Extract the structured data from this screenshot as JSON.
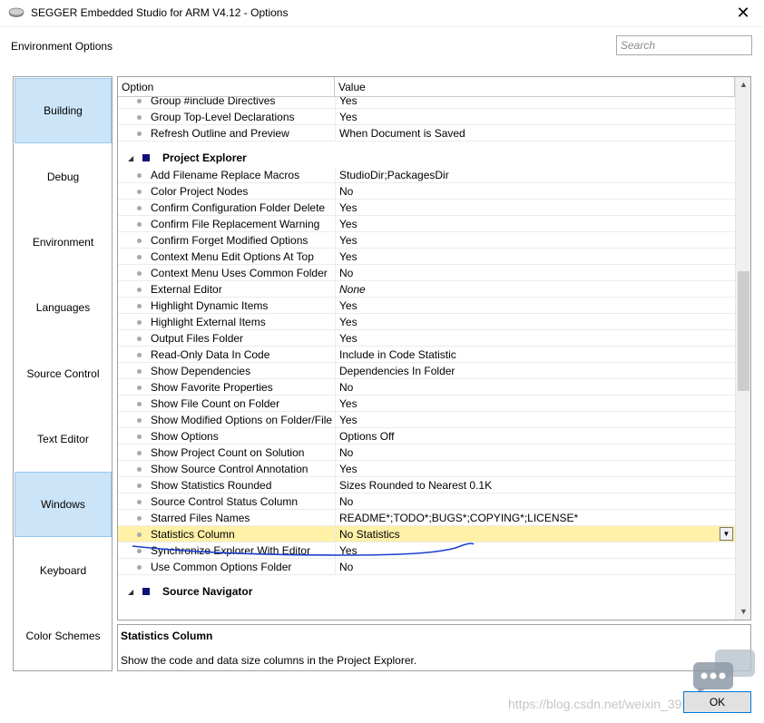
{
  "window": {
    "title": "SEGGER Embedded Studio for ARM V4.12 - Options",
    "close_glyph": "✕"
  },
  "header": {
    "title": "Environment Options",
    "search_placeholder": "Search"
  },
  "sidebar": {
    "items": [
      {
        "label": "Building"
      },
      {
        "label": "Debug"
      },
      {
        "label": "Environment"
      },
      {
        "label": "Languages"
      },
      {
        "label": "Source Control"
      },
      {
        "label": "Text Editor"
      },
      {
        "label": "Windows"
      },
      {
        "label": "Keyboard"
      },
      {
        "label": "Color Schemes"
      }
    ]
  },
  "grid": {
    "columns": [
      "Option",
      "Value"
    ],
    "top_rows": [
      {
        "name": "Group #include Directives",
        "value": "Yes"
      },
      {
        "name": "Group Top-Level Declarations",
        "value": "Yes"
      },
      {
        "name": "Refresh Outline and Preview",
        "value": "When Document is Saved"
      }
    ],
    "group1": "Project Explorer",
    "rows": [
      {
        "name": "Add Filename Replace Macros",
        "value": "StudioDir;PackagesDir"
      },
      {
        "name": "Color Project Nodes",
        "value": "No"
      },
      {
        "name": "Confirm Configuration Folder Delete",
        "value": "Yes"
      },
      {
        "name": "Confirm File Replacement Warning",
        "value": "Yes"
      },
      {
        "name": "Confirm Forget Modified Options",
        "value": "Yes"
      },
      {
        "name": "Context Menu Edit Options At Top",
        "value": "Yes"
      },
      {
        "name": "Context Menu Uses Common Folder",
        "value": "No"
      },
      {
        "name": "External Editor",
        "value": "None"
      },
      {
        "name": "Highlight Dynamic Items",
        "value": "Yes"
      },
      {
        "name": "Highlight External Items",
        "value": "Yes"
      },
      {
        "name": "Output Files Folder",
        "value": "Yes"
      },
      {
        "name": "Read-Only Data In Code",
        "value": "Include in Code Statistic"
      },
      {
        "name": "Show Dependencies",
        "value": "Dependencies In Folder"
      },
      {
        "name": "Show Favorite Properties",
        "value": "No"
      },
      {
        "name": "Show File Count on Folder",
        "value": "Yes"
      },
      {
        "name": "Show Modified Options on Folder/File",
        "value": "Yes"
      },
      {
        "name": "Show Options",
        "value": "Options Off"
      },
      {
        "name": "Show Project Count on Solution",
        "value": "No"
      },
      {
        "name": "Show Source Control Annotation",
        "value": "Yes"
      },
      {
        "name": "Show Statistics Rounded",
        "value": "Sizes Rounded to Nearest 0.1K"
      },
      {
        "name": "Source Control Status Column",
        "value": "No"
      },
      {
        "name": "Starred Files Names",
        "value": "README*;TODO*;BUGS*;COPYING*;LICENSE*"
      },
      {
        "name": "Statistics Column",
        "value": "No Statistics"
      },
      {
        "name": "Synchronize Explorer With Editor",
        "value": "Yes"
      },
      {
        "name": "Use Common Options Folder",
        "value": "No"
      }
    ],
    "group2": "Source Navigator"
  },
  "description": {
    "title": "Statistics Column",
    "body": "Show the code and data size columns in the Project Explorer."
  },
  "buttons": {
    "ok": "OK"
  },
  "watermark": "https://blog.csdn.net/weixin_3951942..."
}
